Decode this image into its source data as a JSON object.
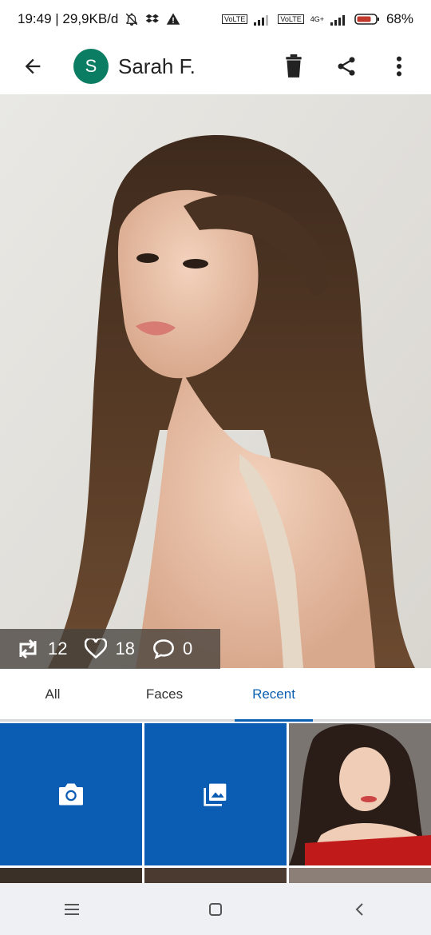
{
  "status_bar": {
    "time_speed": "19:49 | 29,9KB/d",
    "network1": "VoLTE",
    "network2": "VoLTE",
    "network_type": "4G+",
    "battery": "68%"
  },
  "app_bar": {
    "avatar_letter": "S",
    "title": "Sarah F."
  },
  "photo": {
    "reposts": "12",
    "likes": "18",
    "comments": "0"
  },
  "tabs": [
    {
      "label": "All"
    },
    {
      "label": "Faces"
    },
    {
      "label": "Recent"
    }
  ],
  "active_tab": "Recent",
  "colors": {
    "accent": "#0a5fb0",
    "avatar": "#0b7d63",
    "tile": "#0b5db4"
  },
  "icons": [
    "back-icon",
    "trash-icon",
    "share-icon",
    "more-vert-icon",
    "repost-icon",
    "heart-icon",
    "comment-icon",
    "camera-icon",
    "gallery-icon"
  ]
}
